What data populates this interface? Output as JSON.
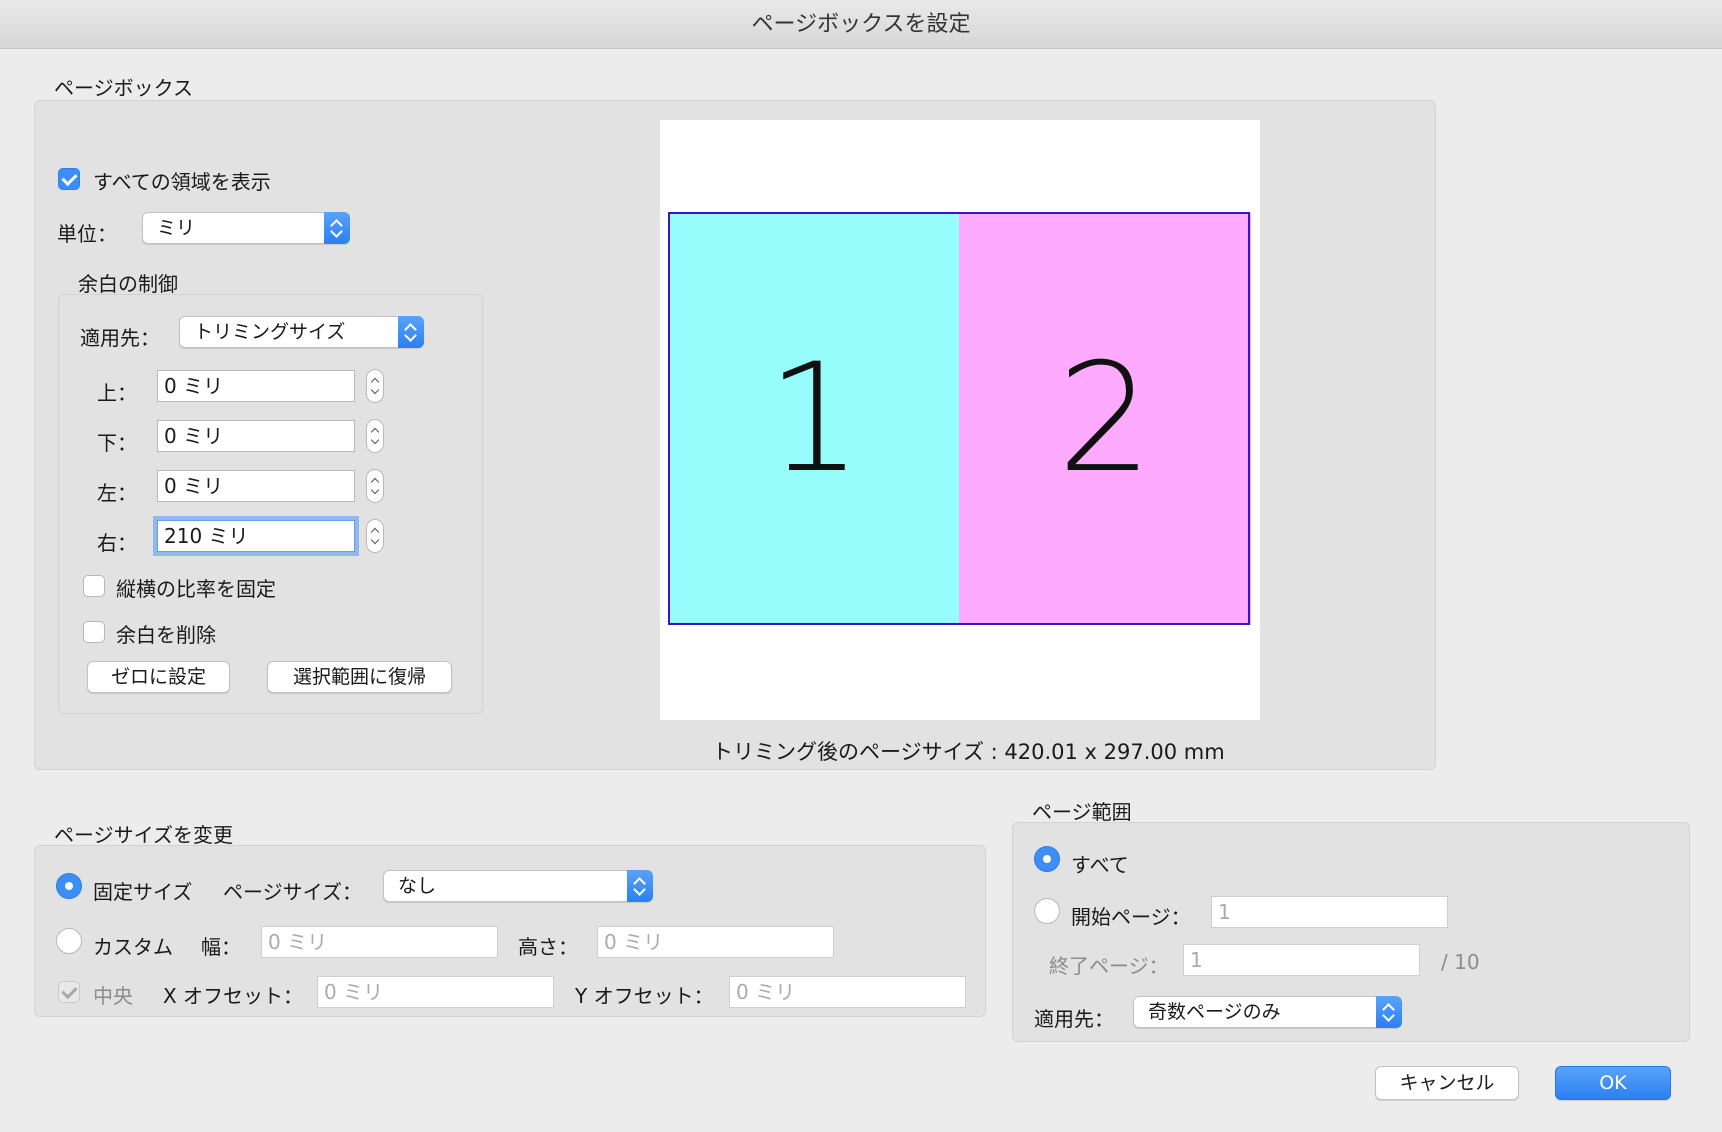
{
  "dialog": {
    "title": "ページボックスを設定"
  },
  "pagebox": {
    "section_label": "ページボックス",
    "show_all_label": "すべての領域を表示",
    "unit_label": "単位：",
    "unit_value": "ミリ"
  },
  "margin": {
    "section_label": "余白の制御",
    "apply_label": "適用先：",
    "apply_value": "トリミングサイズ",
    "top_label": "上：",
    "top_value": "0 ミリ",
    "bottom_label": "下：",
    "bottom_value": "0 ミリ",
    "left_label": "左：",
    "left_value": "0 ミリ",
    "right_label": "右：",
    "right_value": "210 ミリ",
    "lock_ratio_label": "縦横の比率を固定",
    "remove_white_label": "余白を削除",
    "zero_button": "ゼロに設定",
    "revert_button": "選択範囲に復帰"
  },
  "preview": {
    "page1": "1",
    "page2": "2",
    "colors": {
      "page1": "#96fdfb",
      "page2": "#feaafe",
      "border": "#3b13c8"
    },
    "size_text": "トリミング後のページサイズ : 420.01 x 297.00 mm"
  },
  "change_size": {
    "section_label": "ページサイズを変更",
    "fixed_label": "固定サイズ",
    "page_size_label": "ページサイズ：",
    "page_size_value": "なし",
    "custom_label": "カスタム",
    "width_label": "幅：",
    "width_placeholder": "0 ミリ",
    "height_label": "高さ：",
    "height_placeholder": "0 ミリ",
    "center_label": "中央",
    "x_offset_label": "X オフセット：",
    "x_offset_placeholder": "0 ミリ",
    "y_offset_label": "Y オフセット：",
    "y_offset_placeholder": "0 ミリ"
  },
  "page_range": {
    "section_label": "ページ範囲",
    "all_label": "すべて",
    "from_label": "開始ページ：",
    "from_placeholder": "1",
    "to_label": "終了ページ：",
    "to_placeholder": "1",
    "total": "/ 10",
    "apply_label": "適用先：",
    "apply_value": "奇数ページのみ"
  },
  "buttons": {
    "cancel": "キャンセル",
    "ok": "OK"
  },
  "accent_color": "#3b8ef5"
}
